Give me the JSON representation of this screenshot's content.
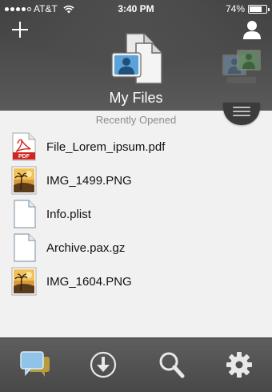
{
  "status_bar": {
    "carrier": "AT&T",
    "time": "3:40 PM",
    "battery_percent": "74%",
    "battery_level": 0.74,
    "signal_icon": "signal-dots-icon",
    "wifi_icon": "wifi-icon"
  },
  "header": {
    "title": "My Files",
    "add_icon": "plus-icon",
    "user_icon": "user-icon",
    "logo_icon": "files-logo-icon",
    "accounts_icon": "accounts-icon",
    "menu_icon": "menu-handle-icon"
  },
  "section": {
    "label": "Recently Opened"
  },
  "files": [
    {
      "name": "File_Lorem_ipsum.pdf",
      "icon": "pdf-file-icon",
      "badge": "PDF"
    },
    {
      "name": "IMG_1499.PNG",
      "icon": "image-file-icon"
    },
    {
      "name": "Info.plist",
      "icon": "document-file-icon"
    },
    {
      "name": "Archive.pax.gz",
      "icon": "document-file-icon"
    },
    {
      "name": "IMG_1604.PNG",
      "icon": "image-file-icon"
    }
  ],
  "tabbar": {
    "tabs": [
      {
        "icon": "chat-icon"
      },
      {
        "icon": "download-icon"
      },
      {
        "icon": "search-icon"
      },
      {
        "icon": "gear-icon"
      }
    ]
  },
  "colors": {
    "header_bg": "#4b4b4b",
    "content_bg": "#f1f1f1",
    "tabbar_bg": "#525252",
    "pdf_red": "#d0241e",
    "accent_blue": "#2f7fbf",
    "accent_green": "#4f9a3f"
  }
}
